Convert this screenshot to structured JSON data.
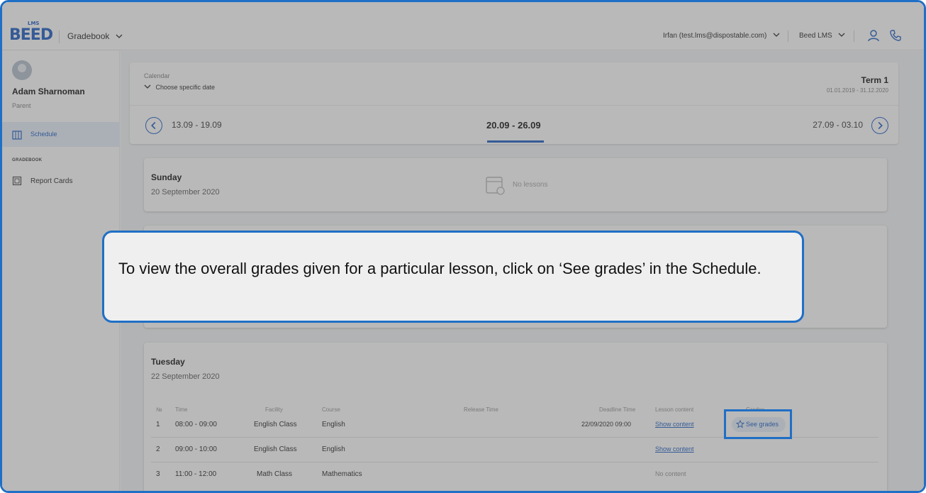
{
  "header": {
    "logo_text": "BEED",
    "logo_sup": "LMS",
    "module": "Gradebook",
    "user_account": "Irfan (test.lms@dispostable.com)",
    "organization": "Beed LMS",
    "icons": [
      "user-icon",
      "phone-icon"
    ]
  },
  "sidebar": {
    "user_name": "Adam Sharnoman",
    "user_role": "Parent",
    "schedule_label": "Schedule",
    "section_label": "GRADEBOOK",
    "report_cards_label": "Report Cards"
  },
  "calendar": {
    "label": "Calendar",
    "choose": "Choose specific date",
    "term": "Term 1",
    "term_dates": "01.01.2019 - 31.12.2020"
  },
  "weeks": {
    "prev": "13.09 - 19.09",
    "current": "20.09 - 26.09",
    "next": "27.09 - 03.10"
  },
  "days": {
    "sunday": {
      "name": "Sunday",
      "date": "20 September 2020",
      "empty": "No lessons"
    },
    "tuesday": {
      "name": "Tuesday",
      "date": "22 September 2020",
      "columns": {
        "num": "№",
        "time": "Time",
        "facility": "Facility",
        "course": "Course",
        "release": "Release Time",
        "deadline": "Deadline Time",
        "content": "Lesson content",
        "grades": "Grades"
      },
      "rows": [
        {
          "num": "1",
          "time": "08:00 - 09:00",
          "facility": "English Class",
          "course": "English",
          "deadline": "22/09/2020 09:00",
          "content": "Show content",
          "grades": "See grades"
        },
        {
          "num": "2",
          "time": "09:00 - 10:00",
          "facility": "English Class",
          "course": "English",
          "deadline": "",
          "content": "Show content",
          "grades": ""
        },
        {
          "num": "3",
          "time": "11:00 - 12:00",
          "facility": "Math Class",
          "course": "Mathematics",
          "deadline": "",
          "content": "No content",
          "grades": ""
        }
      ]
    }
  },
  "tooltip": {
    "text": "To view the overall grades given for a particular lesson, click on ‘See grades’ in the Schedule."
  },
  "colors": {
    "accent": "#2b67c7",
    "highlight_border": "#1f6fc6"
  }
}
